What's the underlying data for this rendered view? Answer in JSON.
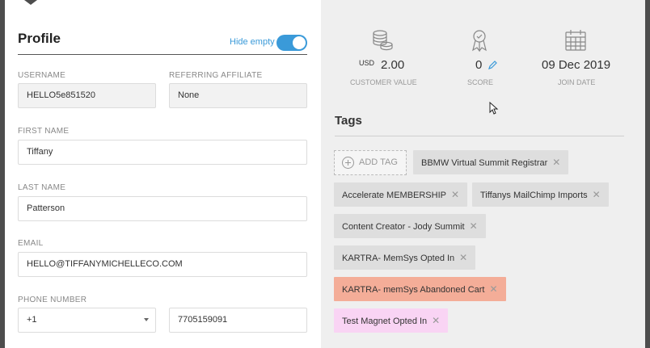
{
  "profile": {
    "title": "Profile",
    "hide_empty_label": "Hide empty",
    "hide_empty_on": true
  },
  "fields": {
    "username": {
      "label": "USERNAME",
      "value": "HELLO5e851520"
    },
    "referring_affiliate": {
      "label": "REFERRING AFFILIATE",
      "value": "None"
    },
    "first_name": {
      "label": "FIRST NAME",
      "value": "Tiffany"
    },
    "last_name": {
      "label": "LAST NAME",
      "value": "Patterson"
    },
    "email": {
      "label": "EMAIL",
      "value": "HELLO@TIFFANYMICHELLECO.COM"
    },
    "phone": {
      "label": "PHONE NUMBER",
      "country_code": "+1",
      "number": "7705159091"
    }
  },
  "stats": {
    "customer_value": {
      "currency": "USD",
      "value": "2.00",
      "label": "CUSTOMER VALUE",
      "icon": "coins-icon"
    },
    "score": {
      "value": "0",
      "label": "SCORE",
      "icon": "award-ribbon-icon"
    },
    "join_date": {
      "value": "09 Dec 2019",
      "label": "JOIN DATE",
      "icon": "calendar-icon"
    }
  },
  "tags": {
    "title": "Tags",
    "add_label": "ADD TAG",
    "items": [
      {
        "label": "BBMW Virtual Summit Registrar",
        "color": "#dedede"
      },
      {
        "label": "Accelerate MEMBERSHIP",
        "color": "#dedede"
      },
      {
        "label": "Tiffanys MailChimp Imports",
        "color": "#dedede"
      },
      {
        "label": "Content Creator - Jody Summit",
        "color": "#dedede"
      },
      {
        "label": "KARTRA- MemSys Opted In",
        "color": "#dedede"
      },
      {
        "label": "KARTRA- memSys Abandoned Cart",
        "color": "#f4ad98"
      },
      {
        "label": "Test Magnet Opted In",
        "color": "#f9d4f4"
      }
    ]
  },
  "colors": {
    "accent": "#3a9ad9",
    "panel_right": "#efefef",
    "tag_default": "#dedede"
  }
}
